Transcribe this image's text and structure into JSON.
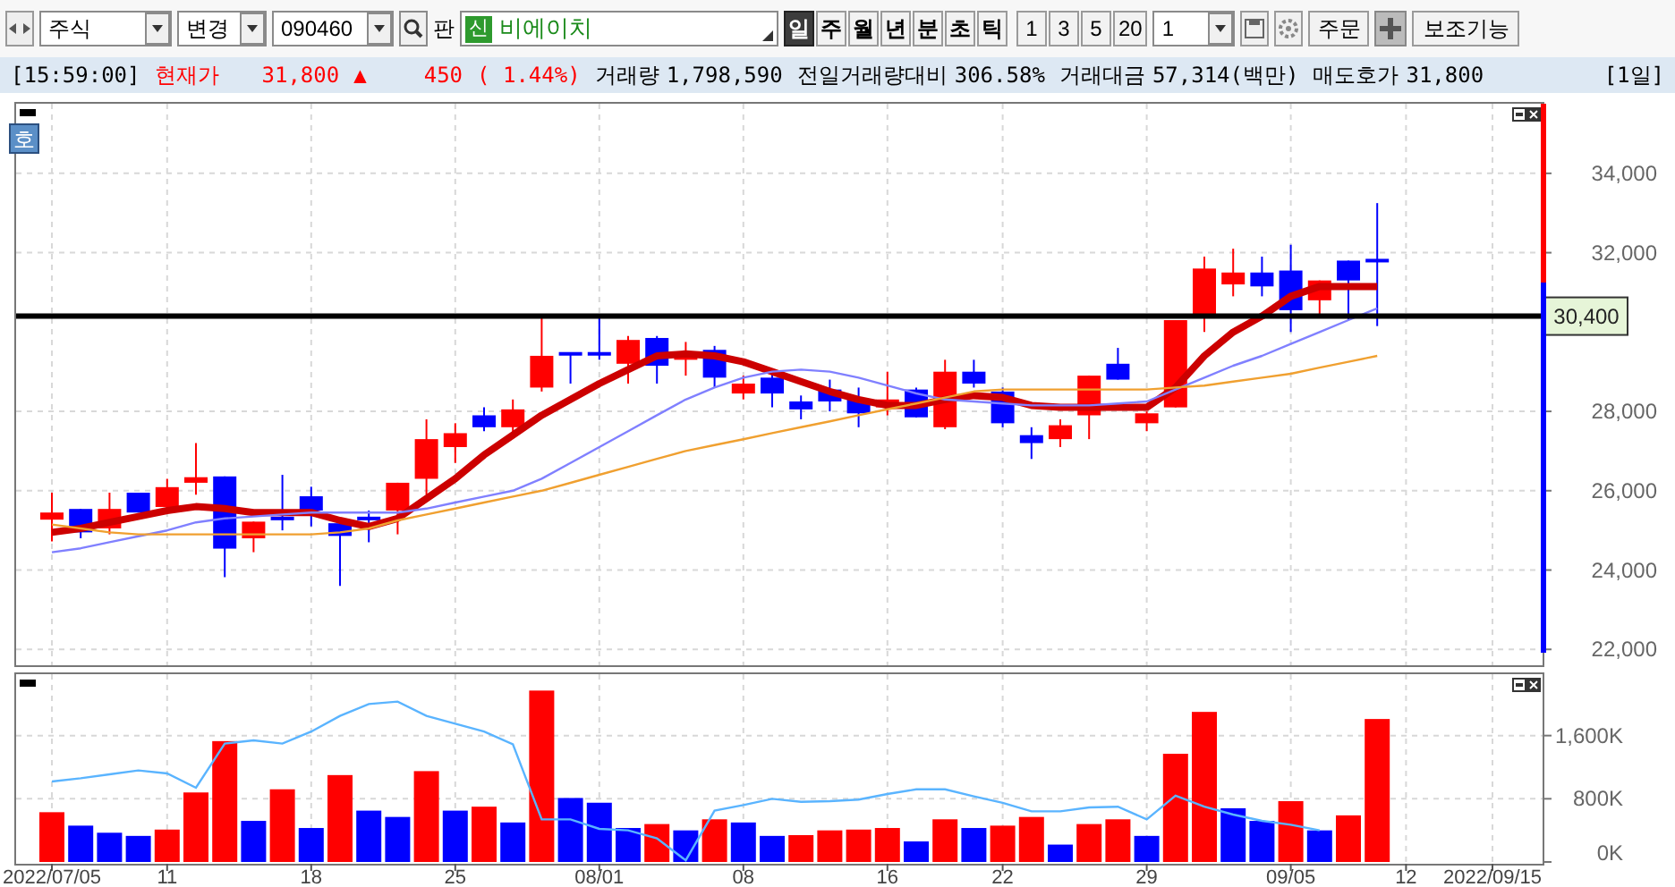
{
  "toolbar": {
    "market_select": {
      "value": "주식"
    },
    "change_select": {
      "value": "변경"
    },
    "code_field": {
      "value": "090460"
    },
    "board_label": "판",
    "name_field": {
      "badge": "신",
      "value": "비에이치"
    },
    "period_tabs": [
      {
        "label": "일",
        "selected": true
      },
      {
        "label": "주",
        "selected": false
      },
      {
        "label": "월",
        "selected": false
      },
      {
        "label": "년",
        "selected": false
      },
      {
        "label": "분",
        "selected": false
      },
      {
        "label": "초",
        "selected": false
      },
      {
        "label": "틱",
        "selected": false
      }
    ],
    "interval_buttons": [
      "1",
      "3",
      "5",
      "20"
    ],
    "count_select": {
      "value": "1"
    },
    "order_button": "주문",
    "aux_button": "보조기능"
  },
  "info_bar": {
    "time": "[15:59:00]",
    "price_label": "현재가",
    "price": "31,800",
    "rising": true,
    "change_sign": "▲",
    "change": "450",
    "change_rate": "( 1.44%)",
    "stats": [
      {
        "label": "거래량",
        "value": "1,798,590"
      },
      {
        "label": "전일거래량대비",
        "value": "306.58%"
      },
      {
        "label": "거래대금",
        "value": "57,314(백만)"
      },
      {
        "label": "매도호가",
        "value": "31,800"
      }
    ],
    "period": "[1일]"
  },
  "price_chart": {
    "quote_button": "호",
    "chart_data": {
      "type": "candlestick",
      "grid": true,
      "ylim": [
        21600,
        35800
      ],
      "categories": [
        null,
        null,
        null,
        null,
        null,
        null,
        null,
        null,
        null,
        null,
        null,
        null,
        null,
        null,
        null,
        null,
        null,
        null,
        null,
        null,
        null,
        null,
        null,
        null,
        null,
        null,
        null,
        null,
        null,
        null,
        null,
        null,
        null,
        null,
        null,
        null,
        null,
        null,
        null,
        null,
        null,
        null,
        null,
        null,
        null,
        null,
        null,
        null,
        null,
        null,
        null
      ],
      "yticks": [
        {
          "value": 22000,
          "label": "22,000"
        },
        {
          "value": 24000,
          "label": "24,000"
        },
        {
          "value": 26000,
          "label": "26,000"
        },
        {
          "value": 28000,
          "label": "28,000"
        },
        {
          "value": 32000,
          "label": "32,000"
        },
        {
          "value": 34000,
          "label": "34,000"
        }
      ],
      "ohlc": [
        [
          25270,
          25950,
          24720,
          25450
        ],
        [
          25540,
          25540,
          24800,
          24950
        ],
        [
          25050,
          25950,
          24900,
          25540
        ],
        [
          25950,
          25950,
          25450,
          25450
        ],
        [
          25590,
          26300,
          25500,
          26090
        ],
        [
          26200,
          27200,
          25900,
          26340
        ],
        [
          26360,
          26360,
          23820,
          24540
        ],
        [
          24800,
          25220,
          24450,
          25220
        ],
        [
          25300,
          26400,
          25000,
          25300
        ],
        [
          25860,
          26100,
          25100,
          25500
        ],
        [
          25180,
          25180,
          23600,
          24860
        ],
        [
          25300,
          25500,
          24700,
          25300
        ],
        [
          25500,
          26200,
          24900,
          26200
        ],
        [
          26300,
          27800,
          25900,
          27300
        ],
        [
          27100,
          27700,
          26700,
          27450
        ],
        [
          27900,
          28100,
          27500,
          27600
        ],
        [
          27600,
          28300,
          27400,
          28050
        ],
        [
          28600,
          30400,
          28500,
          29400
        ],
        [
          29450,
          29450,
          28700,
          29450
        ],
        [
          29450,
          30350,
          29300,
          29450
        ],
        [
          29200,
          29900,
          28700,
          29800
        ],
        [
          29850,
          29900,
          28700,
          29150
        ],
        [
          29300,
          29750,
          28900,
          29400
        ],
        [
          29550,
          29650,
          28600,
          28850
        ],
        [
          28450,
          28900,
          28300,
          28700
        ],
        [
          28850,
          29000,
          28100,
          28450
        ],
        [
          28250,
          28400,
          27800,
          28050
        ],
        [
          28550,
          28800,
          28000,
          28250
        ],
        [
          28300,
          28600,
          27600,
          27950
        ],
        [
          28100,
          29000,
          27900,
          28300
        ],
        [
          28550,
          28600,
          27850,
          27850
        ],
        [
          27600,
          29300,
          27550,
          29000
        ],
        [
          29000,
          29300,
          28600,
          28700
        ],
        [
          28500,
          28600,
          27600,
          27700
        ],
        [
          27400,
          27600,
          26800,
          27200
        ],
        [
          27300,
          27800,
          27100,
          27650
        ],
        [
          27900,
          28900,
          27300,
          28900
        ],
        [
          29200,
          29600,
          28800,
          28800
        ],
        [
          27700,
          28000,
          27500,
          27950
        ],
        [
          28100,
          30300,
          28100,
          30300
        ],
        [
          30400,
          31900,
          30000,
          31600
        ],
        [
          31200,
          32100,
          30900,
          31500
        ],
        [
          31500,
          31900,
          30900,
          31150
        ],
        [
          31550,
          32200,
          30000,
          30550
        ],
        [
          30800,
          31300,
          30350,
          31300
        ],
        [
          31800,
          31800,
          30300,
          31300
        ],
        [
          31800,
          33250,
          30150,
          31800
        ],
        null,
        null,
        null,
        null
      ],
      "series": [
        {
          "type": "line",
          "color": "#cc0000",
          "values": [
            24950,
            25050,
            25200,
            25350,
            25500,
            25600,
            25550,
            25450,
            25450,
            25450,
            25250,
            25100,
            25300,
            25800,
            26300,
            26900,
            27400,
            27900,
            28300,
            28700,
            29050,
            29400,
            29450,
            29400,
            29250,
            29000,
            28750,
            28500,
            28300,
            28150,
            28150,
            28300,
            28400,
            28350,
            28150,
            28100,
            28100,
            28100,
            28100,
            28600,
            29400,
            30000,
            30400,
            30900,
            31150,
            31150,
            31150,
            null,
            null,
            null,
            null
          ]
        },
        {
          "type": "line",
          "color": "#8080ff",
          "values": [
            24450,
            24550,
            24700,
            24850,
            25000,
            25200,
            25300,
            25350,
            25400,
            25450,
            25450,
            25450,
            25450,
            25550,
            25700,
            25850,
            26000,
            26300,
            26700,
            27100,
            27500,
            27900,
            28300,
            28600,
            28850,
            29000,
            29050,
            29000,
            28850,
            28650,
            28450,
            28300,
            28250,
            28200,
            28150,
            28150,
            28150,
            28200,
            28250,
            28550,
            28850,
            29150,
            29400,
            29700,
            30000,
            30300,
            30600,
            null,
            null,
            null,
            null
          ]
        },
        {
          "type": "line",
          "color": "#f0a030",
          "values": [
            25150,
            25050,
            24950,
            24900,
            24900,
            24900,
            24900,
            24900,
            24900,
            24900,
            24950,
            25050,
            25250,
            25400,
            25550,
            25700,
            25850,
            26000,
            26200,
            26400,
            26600,
            26800,
            27000,
            27150,
            27300,
            27450,
            27600,
            27750,
            27900,
            28050,
            28200,
            28350,
            28500,
            28550,
            28550,
            28550,
            28550,
            28550,
            28550,
            28600,
            28650,
            28750,
            28850,
            28950,
            29100,
            29250,
            29400,
            null,
            null,
            null,
            null
          ]
        }
      ],
      "ref_lines": [
        {
          "axis": "y",
          "value": 30400,
          "label": "30,400"
        }
      ]
    }
  },
  "volume_chart": {
    "chart_data": {
      "type": "bar",
      "stacked": false,
      "grid": true,
      "ylim": [
        0,
        2400
      ],
      "categories": [
        "2022/07/05",
        null,
        null,
        null,
        "11",
        null,
        null,
        null,
        null,
        "18",
        null,
        null,
        null,
        null,
        "25",
        null,
        null,
        null,
        null,
        "08/01",
        null,
        null,
        null,
        null,
        "08",
        null,
        null,
        null,
        null,
        "16",
        null,
        null,
        null,
        "22",
        null,
        null,
        null,
        null,
        "29",
        null,
        null,
        null,
        null,
        "09/05",
        null,
        null,
        null,
        "12",
        null,
        null,
        "2022/09/15"
      ],
      "yticks": [
        {
          "value": 0,
          "label": "0K"
        },
        {
          "value": 800,
          "label": "800K"
        },
        {
          "value": 1600,
          "label": "1,600K"
        }
      ],
      "series": [
        {
          "colors": [
            "#ff0000",
            "#0000ff",
            "#0000ff",
            "#0000ff",
            "#ff0000",
            "#ff0000",
            "#ff0000",
            "#0000ff",
            "#ff0000",
            "#0000ff",
            "#ff0000",
            "#0000ff",
            "#0000ff",
            "#ff0000",
            "#0000ff",
            "#ff0000",
            "#0000ff",
            "#ff0000",
            "#0000ff",
            "#0000ff",
            "#0000ff",
            "#ff0000",
            "#0000ff",
            "#ff0000",
            "#0000ff",
            "#0000ff",
            "#ff0000",
            "#ff0000",
            "#ff0000",
            "#ff0000",
            "#0000ff",
            "#ff0000",
            "#0000ff",
            "#ff0000",
            "#ff0000",
            "#0000ff",
            "#ff0000",
            "#ff0000",
            "#0000ff",
            "#ff0000",
            "#ff0000",
            "#0000ff",
            "#0000ff",
            "#ff0000",
            "#0000ff",
            "#ff0000",
            "#ff0000",
            null,
            null,
            null,
            null
          ],
          "values": [
            630,
            460,
            370,
            330,
            410,
            880,
            1530,
            520,
            920,
            430,
            1100,
            650,
            570,
            1150,
            650,
            700,
            500,
            2170,
            810,
            750,
            430,
            480,
            400,
            540,
            500,
            330,
            340,
            400,
            410,
            430,
            260,
            540,
            430,
            460,
            570,
            220,
            480,
            540,
            330,
            1370,
            1900,
            680,
            520,
            770,
            400,
            590,
            1810,
            null,
            null,
            null,
            null
          ]
        },
        {
          "type": "line",
          "color": "#5ab4ff",
          "values": [
            1020,
            1060,
            1110,
            1160,
            1120,
            940,
            1500,
            1540,
            1500,
            1650,
            1850,
            2000,
            2030,
            1850,
            1750,
            1650,
            1490,
            540,
            540,
            420,
            400,
            300,
            20,
            650,
            720,
            800,
            760,
            770,
            790,
            860,
            920,
            920,
            830,
            750,
            640,
            640,
            690,
            700,
            540,
            840,
            700,
            600,
            520,
            470,
            400,
            null,
            null,
            null,
            null,
            null,
            null
          ]
        }
      ]
    }
  }
}
